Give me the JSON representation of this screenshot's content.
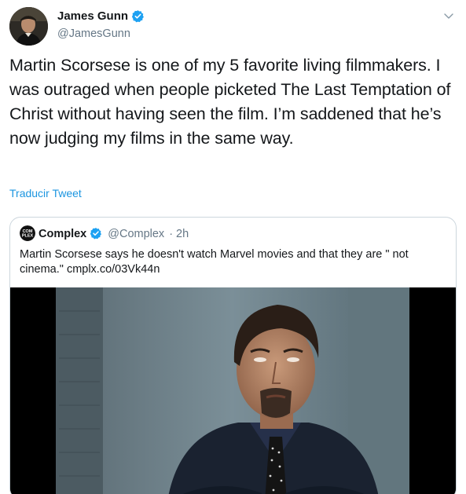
{
  "author": {
    "name": "James Gunn",
    "handle": "@JamesGunn"
  },
  "tweet": {
    "text": "Martin Scorsese is one of my 5 favorite living filmmakers. I was outraged when people picketed The Last Temptation of Christ without having seen the film. I’m saddened that he’s now judging my films in the same way.",
    "translate_label": "Traducir Tweet"
  },
  "quoted": {
    "name": "Complex",
    "handle": "@Complex",
    "time": "2h",
    "text": "Martin Scorsese says he doesn't watch Marvel movies and that they are \" not cinema.\" cmplx.co/03Vk44n",
    "avatar_text": "COM PLEX"
  },
  "colors": {
    "link_blue": "#1b95e0",
    "verified_blue": "#1da1f2",
    "secondary_text": "#657786",
    "border": "#ccd6dd"
  },
  "icons": {
    "verified": "verified-badge-icon",
    "caret": "chevron-down-icon"
  }
}
